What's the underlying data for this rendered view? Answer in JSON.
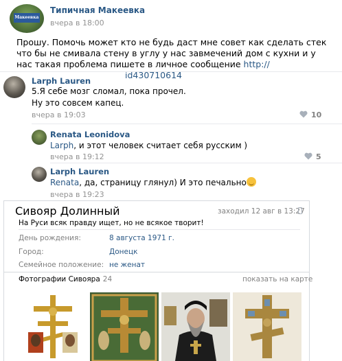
{
  "post": {
    "group_name": "Типичная Макеевка",
    "avatar_text": "Макеевка",
    "time": "вчера в 18:00",
    "text": "Прошу. Помочь может кто не будь даст мне совет как сделать стек что бы не смивала стену в углу у нас завмечений дом с кухни и у нас такая проблема пишете в личное сообщение",
    "link_start": "http://",
    "link_end": "id430710614"
  },
  "comments": [
    {
      "author": "Larph Lauren",
      "text_line1": "5.Я себе мозг сломал, пока прочел.",
      "text_line2": "Ну это совсем капец.",
      "time": "вчера в 19:03",
      "likes": "10"
    },
    {
      "author": "Renata Leonidova",
      "reply_to": "Larph",
      "text": ", и этот человек считает себя русским )",
      "time": "вчера в 19:12",
      "likes": "5"
    },
    {
      "author": "Larph Lauren",
      "reply_to": "Renata",
      "text": ", да, страницу глянул) И это печально",
      "time": "вчера в 19:23"
    }
  ],
  "profile": {
    "name": "Сивояр Долинный",
    "last_seen": "заходил 12 авг в 13:27",
    "status": "На Руси всяк правду ищет, но не всякое творит!",
    "fields": [
      {
        "label": "День рождения:",
        "value": "8 августа 1971 г."
      },
      {
        "label": "Город:",
        "value": "Донецк"
      },
      {
        "label": "Семейное положение:",
        "value": "не женат"
      }
    ],
    "photos_title": "Фотографии Сивояра",
    "photos_count": "24",
    "map_link": "показать на карте"
  },
  "colors": {
    "link": "#2a5885",
    "muted": "#939393",
    "border": "#e7e8ec"
  }
}
